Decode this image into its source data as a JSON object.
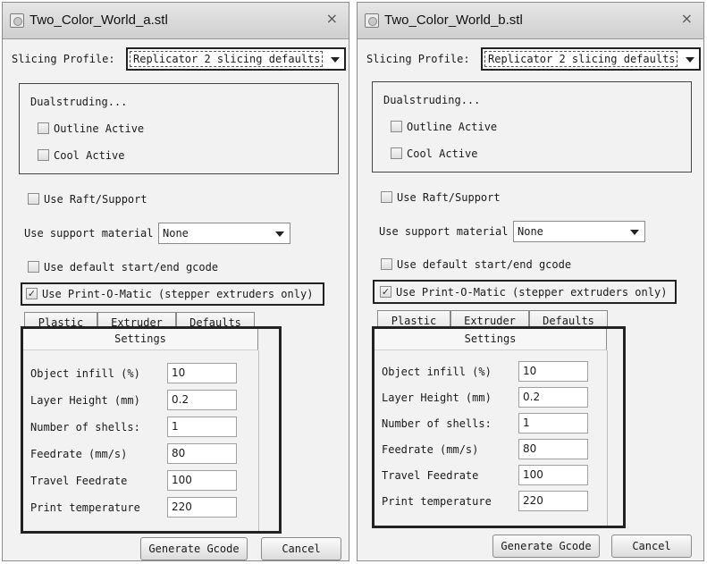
{
  "window_a": {
    "title": "Two_Color_World_a.stl",
    "close_glyph": "×",
    "slicing_profile_label": "Slicing Profile:",
    "slicing_profile_value": "Replicator 2 slicing defaults",
    "dualstruding_title": "Dualstruding...",
    "outline_active_label": "Outline Active",
    "outline_active_checked": false,
    "cool_active_label": "Cool Active",
    "cool_active_checked": false,
    "raft_label": "Use Raft/Support",
    "raft_checked": false,
    "support_label": "Use support material",
    "support_value": "None",
    "default_gcode_label": "Use default start/end gcode",
    "default_gcode_checked": false,
    "print_o_matic_label": "Use Print-O-Matic (stepper extruders only)",
    "print_o_matic_checked": true,
    "check_glyph": "✓",
    "tabs": [
      "Plastic",
      "Extruder",
      "Defaults"
    ],
    "settings_tab": "Settings",
    "settings": [
      {
        "label": "Object infill (%)",
        "value": "10"
      },
      {
        "label": "Layer Height (mm)",
        "value": "0.2"
      },
      {
        "label": "Number of shells:",
        "value": "1"
      },
      {
        "label": "Feedrate (mm/s)",
        "value": "80"
      },
      {
        "label": "Travel Feedrate",
        "value": "100"
      },
      {
        "label": "Print temperature",
        "value": "220"
      }
    ],
    "generate_button": "Generate Gcode",
    "cancel_button": "Cancel"
  },
  "window_b": {
    "title": "Two_Color_World_b.stl",
    "close_glyph": "⨯",
    "slicing_profile_label": "Slicing Profile:",
    "slicing_profile_value": "Replicator 2 slicing defaults",
    "dualstruding_title": "Dualstruding...",
    "outline_active_label": "Outline Active",
    "outline_active_checked": false,
    "cool_active_label": "Cool Active",
    "cool_active_checked": false,
    "raft_label": "Use Raft/Support",
    "raft_checked": false,
    "support_label": "Use support material",
    "support_value": "None",
    "default_gcode_label": "Use default start/end gcode",
    "default_gcode_checked": false,
    "print_o_matic_label": "Use Print-O-Matic (stepper extruders only)",
    "print_o_matic_checked": true,
    "check_glyph": "✓",
    "tabs": [
      "Plastic",
      "Extruder",
      "Defaults"
    ],
    "settings_tab": "Settings",
    "settings": [
      {
        "label": "Object infill (%)",
        "value": "10"
      },
      {
        "label": "Layer Height (mm)",
        "value": "0.2"
      },
      {
        "label": "Number of shells:",
        "value": "1"
      },
      {
        "label": "Feedrate (mm/s)",
        "value": "80"
      },
      {
        "label": "Travel Feedrate",
        "value": "100"
      },
      {
        "label": "Print temperature",
        "value": "220"
      }
    ],
    "generate_button": "Generate Gcode",
    "cancel_button": "Cancel"
  }
}
